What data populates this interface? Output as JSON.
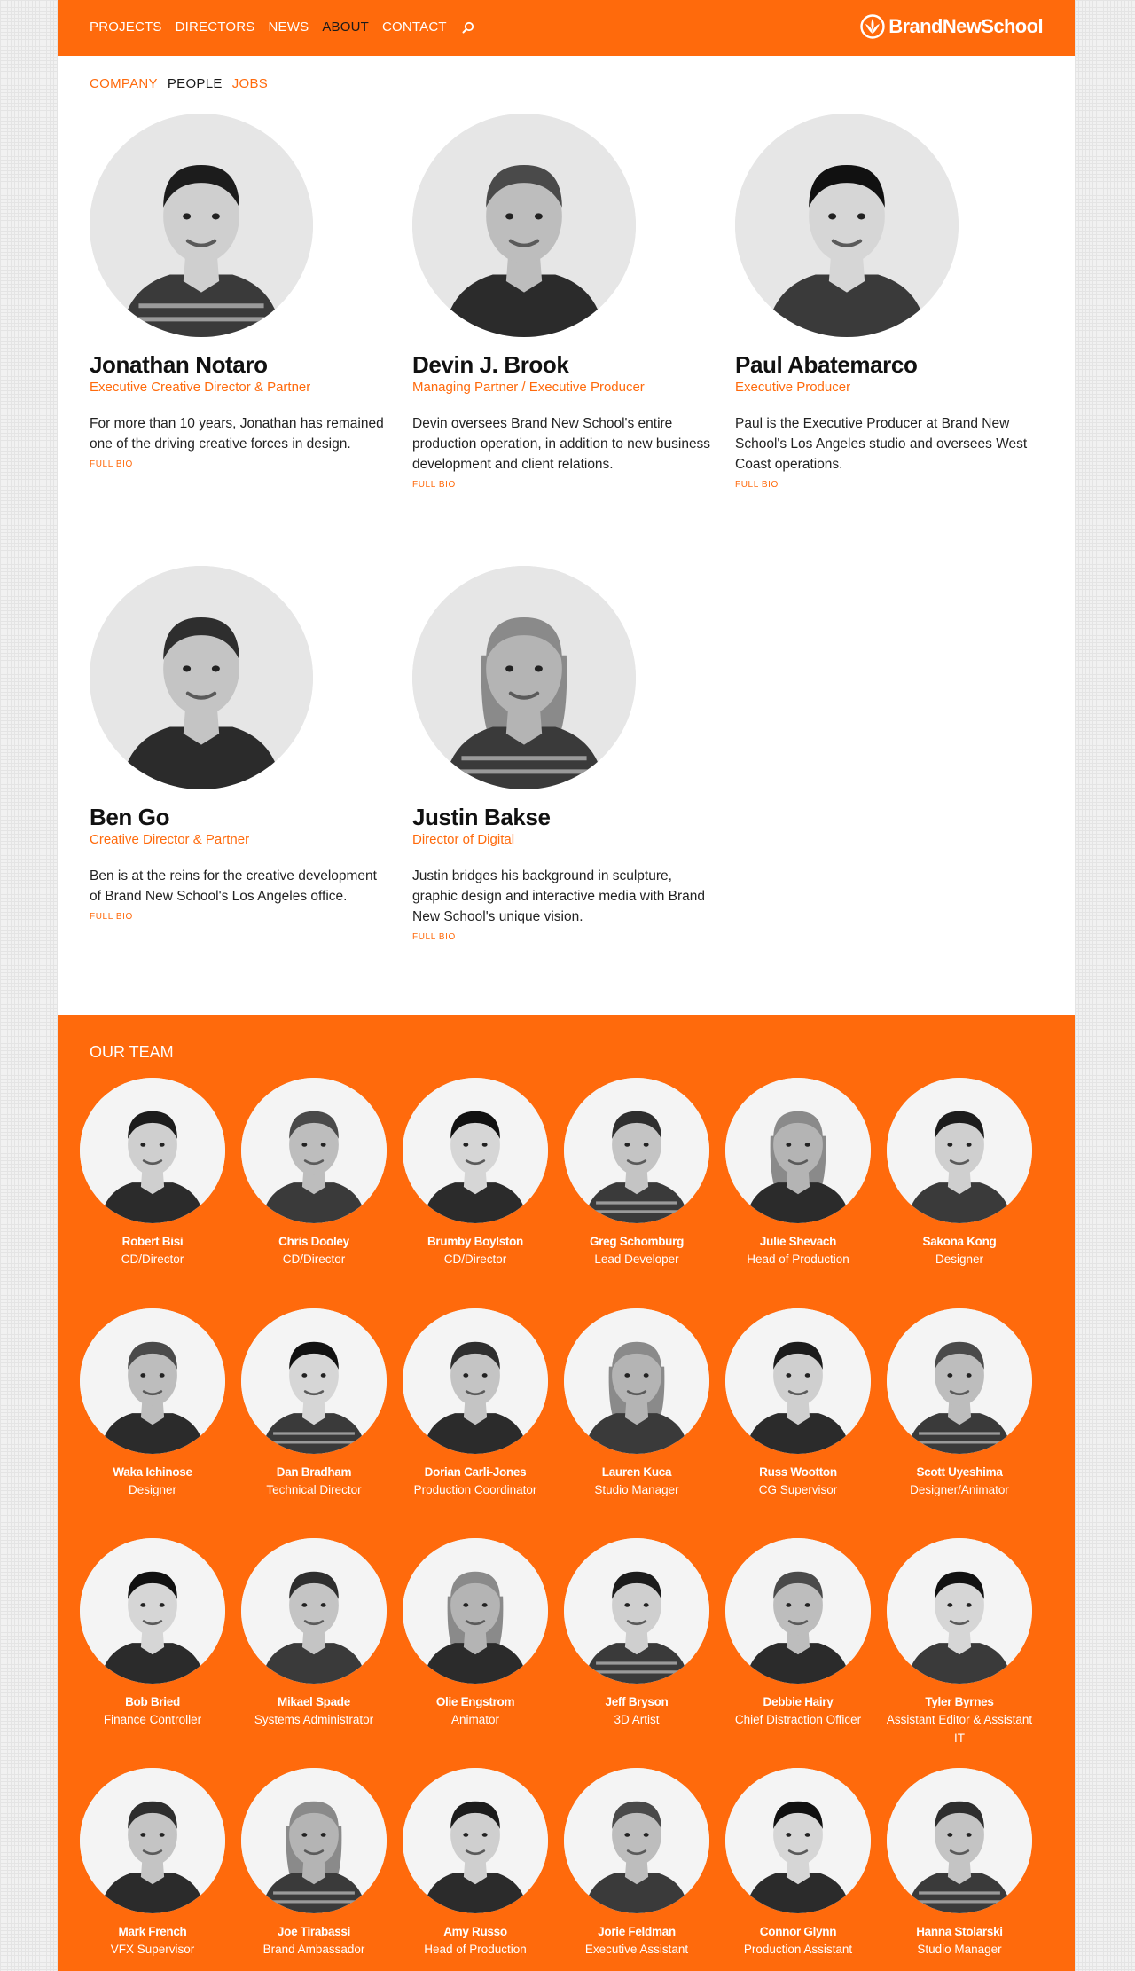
{
  "brand": {
    "name": "BrandNewSchool",
    "accent": "#ff6a0c"
  },
  "nav": [
    {
      "label": "PROJECTS",
      "active": false
    },
    {
      "label": "DIRECTORS",
      "active": false
    },
    {
      "label": "NEWS",
      "active": false
    },
    {
      "label": "ABOUT",
      "active": true
    },
    {
      "label": "CONTACT",
      "active": false
    }
  ],
  "nav_search_icon": "search-icon",
  "subnav": [
    {
      "label": "COMPANY",
      "color": "#ff6a0c"
    },
    {
      "label": "PEOPLE",
      "color": "#1a1a1a"
    },
    {
      "label": "JOBS",
      "color": "#ff6a0c"
    }
  ],
  "partners": [
    {
      "name": "Jonathan Notaro",
      "role": "Executive Creative Director & Partner",
      "bio": "For more than 10 years, Jonathan has remained one of the driving creative forces in design.",
      "link": "FULL BIO"
    },
    {
      "name": "Devin J. Brook",
      "role": "Managing Partner / Executive Producer",
      "bio": "Devin oversees Brand New School's entire production operation, in addition to new business development and client relations.",
      "link": "FULL BIO"
    },
    {
      "name": "Paul Abatemarco",
      "role": "Executive Producer",
      "bio": "Paul is the Executive Producer at Brand New School's Los Angeles studio and oversees West Coast operations.",
      "link": "FULL BIO"
    },
    {
      "name": "Ben Go",
      "role": "Creative Director & Partner",
      "bio": "Ben is at the reins for the creative development of Brand New School's Los Angeles office.",
      "link": "FULL BIO"
    },
    {
      "name": "Justin Bakse",
      "role": "Director of Digital",
      "bio": "Justin bridges his background in sculpture, graphic design and interactive media with Brand New School's unique vision.",
      "link": "FULL BIO"
    }
  ],
  "team": {
    "title": "OUR TEAM",
    "members": [
      {
        "name": "Robert Bisi",
        "role": "CD/Director"
      },
      {
        "name": "Chris Dooley",
        "role": "CD/Director"
      },
      {
        "name": "Brumby Boylston",
        "role": "CD/Director"
      },
      {
        "name": "Greg Schomburg",
        "role": "Lead Developer"
      },
      {
        "name": "Julie Shevach",
        "role": "Head of Production"
      },
      {
        "name": "Sakona Kong",
        "role": "Designer"
      },
      {
        "name": "Waka Ichinose",
        "role": "Designer"
      },
      {
        "name": "Dan Bradham",
        "role": "Technical Director"
      },
      {
        "name": "Dorian Carli-Jones",
        "role": "Production Coordinator"
      },
      {
        "name": "Lauren Kuca",
        "role": "Studio Manager"
      },
      {
        "name": "Russ Wootton",
        "role": "CG Supervisor"
      },
      {
        "name": "Scott Uyeshima",
        "role": "Designer/Animator"
      },
      {
        "name": "Bob Bried",
        "role": "Finance Controller"
      },
      {
        "name": "Mikael Spade",
        "role": "Systems Administrator"
      },
      {
        "name": "Olie Engstrom",
        "role": "Animator"
      },
      {
        "name": "Jeff Bryson",
        "role": "3D Artist"
      },
      {
        "name": "Debbie Hairy",
        "role": "Chief Distraction Officer"
      },
      {
        "name": "Tyler Byrnes",
        "role": "Assistant Editor & Assistant IT"
      },
      {
        "name": "Mark French",
        "role": "VFX Supervisor"
      },
      {
        "name": "Joe Tirabassi",
        "role": "Brand Ambassador"
      },
      {
        "name": "Amy Russo",
        "role": "Head of Production"
      },
      {
        "name": "Jorie Feldman",
        "role": "Executive Assistant"
      },
      {
        "name": "Connor Glynn",
        "role": "Production Assistant"
      },
      {
        "name": "Hanna Stolarski",
        "role": "Studio Manager"
      }
    ]
  }
}
